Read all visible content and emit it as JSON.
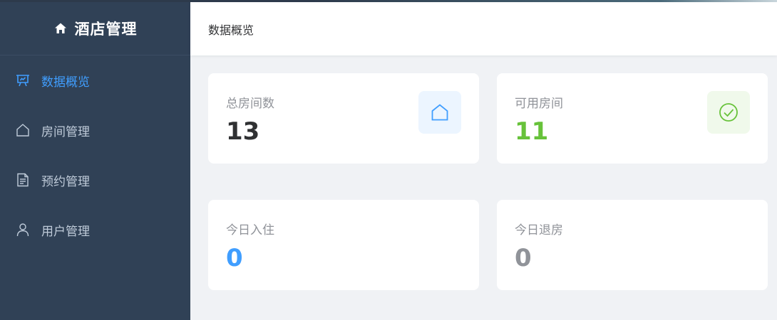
{
  "app": {
    "title": "酒店管理",
    "icon": "home-icon"
  },
  "sidebar": {
    "items": [
      {
        "label": "数据概览",
        "icon": "presentation-board-icon",
        "active": true
      },
      {
        "label": "房间管理",
        "icon": "house-outline-icon",
        "active": false
      },
      {
        "label": "预约管理",
        "icon": "document-icon",
        "active": false
      },
      {
        "label": "用户管理",
        "icon": "user-icon",
        "active": false
      }
    ]
  },
  "header": {
    "breadcrumb": "数据概览"
  },
  "stats": [
    {
      "label": "总房间数",
      "value": "13",
      "color": "#303133",
      "icon": "house-outline-icon",
      "icon_bg": "#ecf5ff"
    },
    {
      "label": "可用房间",
      "value": "11",
      "color": "#67c23a",
      "icon": "check-circle-icon",
      "icon_bg": "#f0f9eb"
    },
    {
      "label": "今日入住",
      "value": "0",
      "color": "#409eff"
    },
    {
      "label": "今日退房",
      "value": "0",
      "color": "#909399"
    }
  ],
  "colors": {
    "sidebar_bg": "#304156",
    "accent": "#409eff",
    "success": "#67c23a",
    "page_bg": "#f0f2f5"
  }
}
